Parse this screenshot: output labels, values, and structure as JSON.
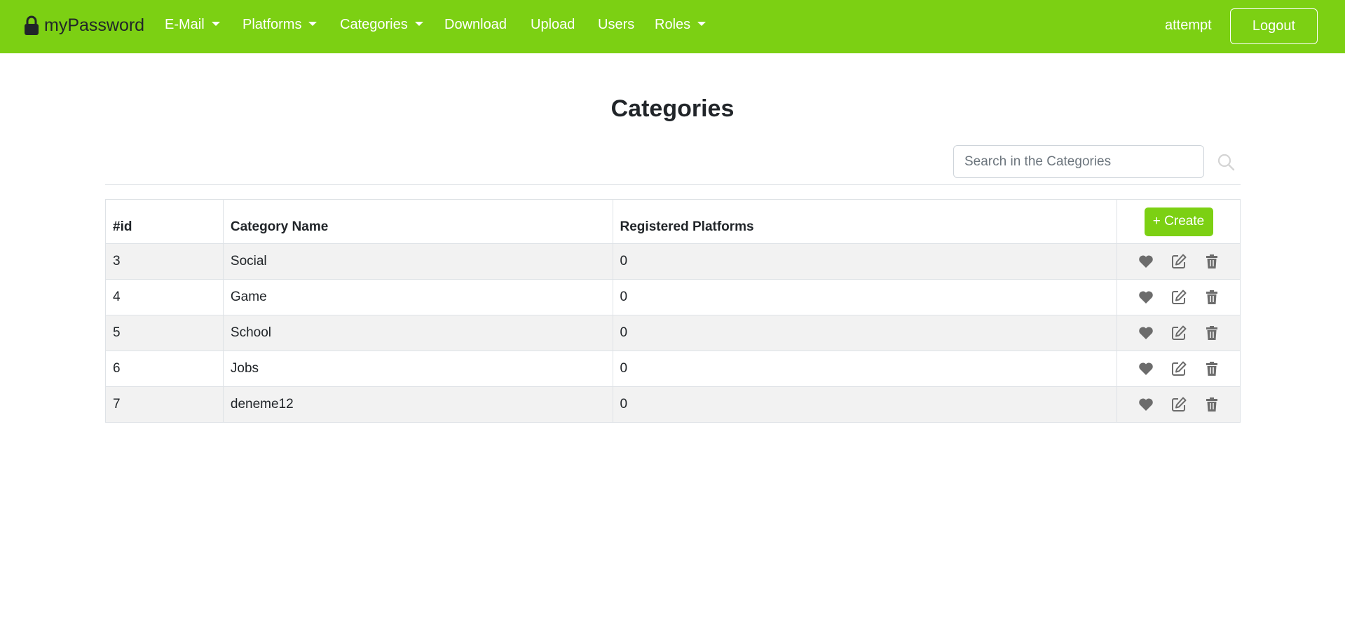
{
  "nav": {
    "brand": "myPassword",
    "items": [
      {
        "label": "E-Mail",
        "dropdown": true
      },
      {
        "label": "Platforms",
        "dropdown": true
      },
      {
        "label": "Categories",
        "dropdown": true
      },
      {
        "label": "Download",
        "dropdown": false
      },
      {
        "label": "Upload",
        "dropdown": false
      },
      {
        "label": "Users",
        "dropdown": false
      },
      {
        "label": "Roles",
        "dropdown": true
      }
    ],
    "user": "attempt",
    "logout_label": "Logout"
  },
  "page": {
    "title": "Categories",
    "search_placeholder": "Search in the Categories"
  },
  "table": {
    "headers": [
      "#id",
      "Category Name",
      "Registered Platforms"
    ],
    "create_label": "+ Create",
    "rows": [
      {
        "id": "3",
        "name": "Social",
        "registered": "0"
      },
      {
        "id": "4",
        "name": "Game",
        "registered": "0"
      },
      {
        "id": "5",
        "name": "School",
        "registered": "0"
      },
      {
        "id": "6",
        "name": "Jobs",
        "registered": "0"
      },
      {
        "id": "7",
        "name": "deneme12",
        "registered": "0"
      }
    ],
    "row_action_icons": [
      "heart-icon",
      "edit-icon",
      "trash-icon"
    ]
  },
  "colors": {
    "accent": "#7cd013",
    "icon_gray": "#6c6c6c"
  }
}
